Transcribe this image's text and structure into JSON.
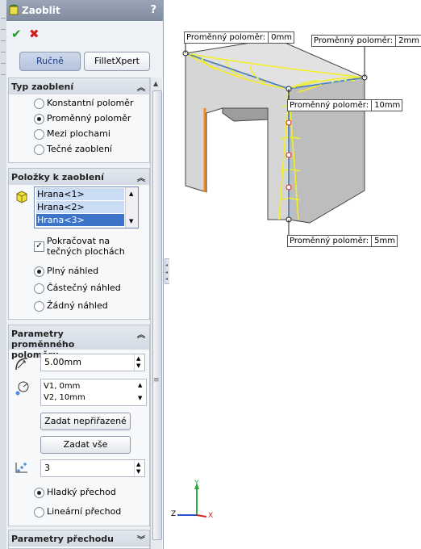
{
  "panel": {
    "title": "Zaoblit",
    "help": "?",
    "ok_icon": "check-icon",
    "cancel_icon": "x-icon",
    "tabs": [
      {
        "label": "Ručně",
        "active": true
      },
      {
        "label": "FilletXpert",
        "active": false
      }
    ]
  },
  "type_section": {
    "heading": "Typ zaoblení",
    "options": [
      {
        "label": "Konstantní poloměr",
        "selected": false
      },
      {
        "label": "Proměnný poloměr",
        "selected": true
      },
      {
        "label": "Mezi plochami",
        "selected": false
      },
      {
        "label": "Tečné zaoblení",
        "selected": false
      }
    ]
  },
  "items_section": {
    "heading": "Položky k zaoblení",
    "list": [
      "Hrana<1>",
      "Hrana<2>",
      "Hrana<3>"
    ],
    "selected_index": 2,
    "tangent_label": "Pokračovat na tečných plochách",
    "tangent_checked": true,
    "preview_options": [
      {
        "label": "Plný náhled",
        "selected": true
      },
      {
        "label": "Částečný náhled",
        "selected": false
      },
      {
        "label": "Žádný náhled",
        "selected": false
      }
    ]
  },
  "params_section": {
    "heading": "Parametry proměnného poloměru",
    "radius_value": "5.00mm",
    "vertex_list": [
      "V1, 0mm",
      "V2, 10mm"
    ],
    "assign_unassigned_label": "Zadat nepřiřazené",
    "assign_all_label": "Zadat vše",
    "instances_value": "3",
    "transition_options": [
      {
        "label": "Hladký přechod",
        "selected": true
      },
      {
        "label": "Lineární přechod",
        "selected": false
      }
    ]
  },
  "transition_section": {
    "heading": "Parametry přechodu"
  },
  "viewport": {
    "callouts": [
      {
        "text": "Proměnný poloměr:",
        "value": "0mm"
      },
      {
        "text": "Proměnný poloměr:",
        "value": "2mm"
      },
      {
        "text": "Proměnný poloměr:",
        "value": "10mm"
      },
      {
        "text": "Proměnný poloměr:",
        "value": "5mm"
      }
    ],
    "triad": {
      "y": "Y",
      "z": "Z",
      "x": "X"
    },
    "colors": {
      "fillet_preview": "#f2ef2a",
      "edge_dash": "#4d8fd6",
      "vertex_marker": "#d02020",
      "highlight_edge": "#f08a1c"
    }
  }
}
